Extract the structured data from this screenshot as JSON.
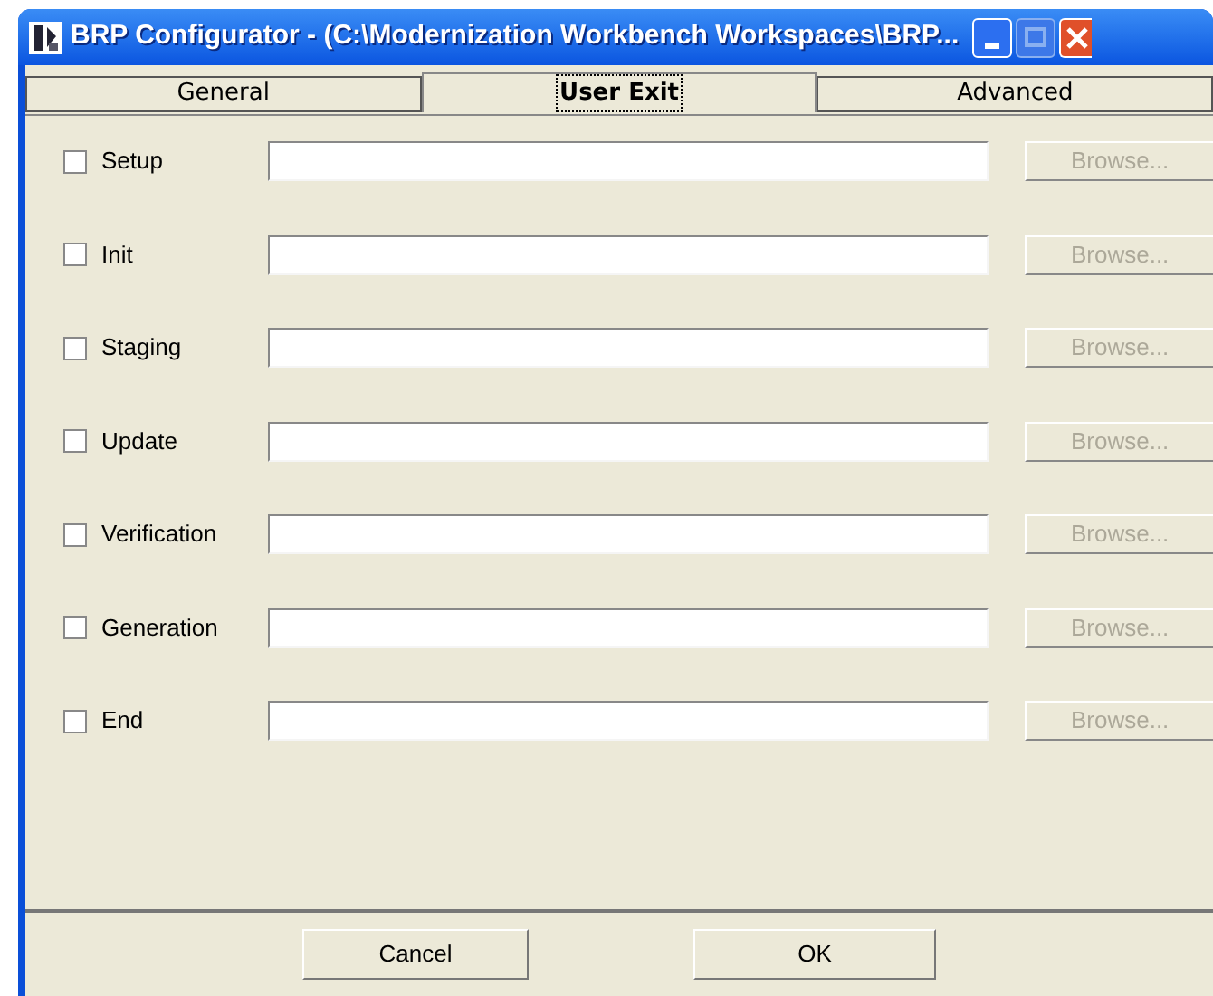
{
  "window": {
    "title": "BRP Configurator - (C:\\Modernization Workbench Workspaces\\BRP..."
  },
  "tabs": [
    {
      "label": "General",
      "selected": false
    },
    {
      "label": "User Exit",
      "selected": true
    },
    {
      "label": "Advanced",
      "selected": false
    }
  ],
  "user_exits": [
    {
      "label": "Setup",
      "checked": false,
      "button": "Browse...",
      "disabled": true
    },
    {
      "label": "Init",
      "checked": false,
      "button": "Browse...",
      "disabled": true
    },
    {
      "label": "Staging",
      "checked": false,
      "button": "Browse...",
      "disabled": true
    },
    {
      "label": "Update",
      "checked": false,
      "button": "Browse...",
      "disabled": true
    },
    {
      "label": "Verification",
      "checked": false,
      "button": "Browse...",
      "disabled": true
    },
    {
      "label": "Generation",
      "checked": false,
      "button": "Browse...",
      "disabled": true
    },
    {
      "label": "End",
      "checked": false,
      "button": "Browse...",
      "disabled": true
    }
  ],
  "buttons": [
    "Cancel",
    "OK"
  ]
}
